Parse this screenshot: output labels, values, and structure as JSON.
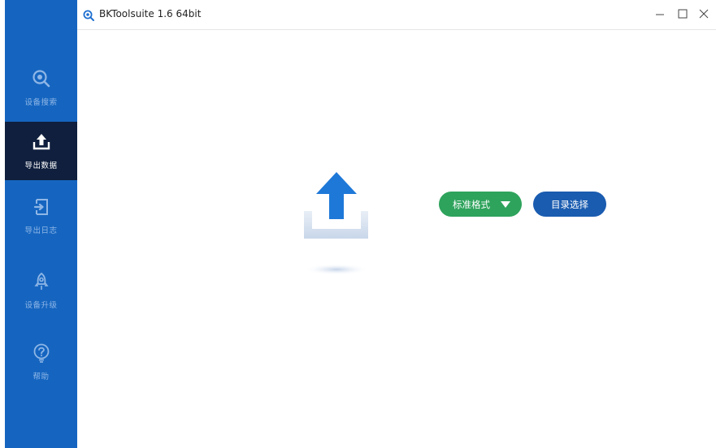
{
  "window": {
    "title": "BKToolsuite 1.6 64bit",
    "controls": {
      "minimize_icon": "minimize-icon",
      "maximize_icon": "maximize-icon",
      "close_icon": "close-icon"
    }
  },
  "sidebar": {
    "items": [
      {
        "label": "设备搜索",
        "icon": "device-search-icon",
        "active": false
      },
      {
        "label": "导出数据",
        "icon": "export-data-icon",
        "active": true
      },
      {
        "label": "导出日志",
        "icon": "export-log-icon",
        "active": false
      },
      {
        "label": "设备升级",
        "icon": "rocket-icon",
        "active": false
      },
      {
        "label": "帮助",
        "icon": "help-icon",
        "active": false
      }
    ]
  },
  "main": {
    "format_select": {
      "value": "标准格式"
    },
    "directory_button": {
      "label": "目录选择"
    }
  },
  "colors": {
    "sidebar": "#1565c0",
    "sidebar_active": "#0f1f3d",
    "format_button": "#2ea35c",
    "directory_button": "#1a5cb0",
    "upload_arrow": "#1e78d8"
  }
}
